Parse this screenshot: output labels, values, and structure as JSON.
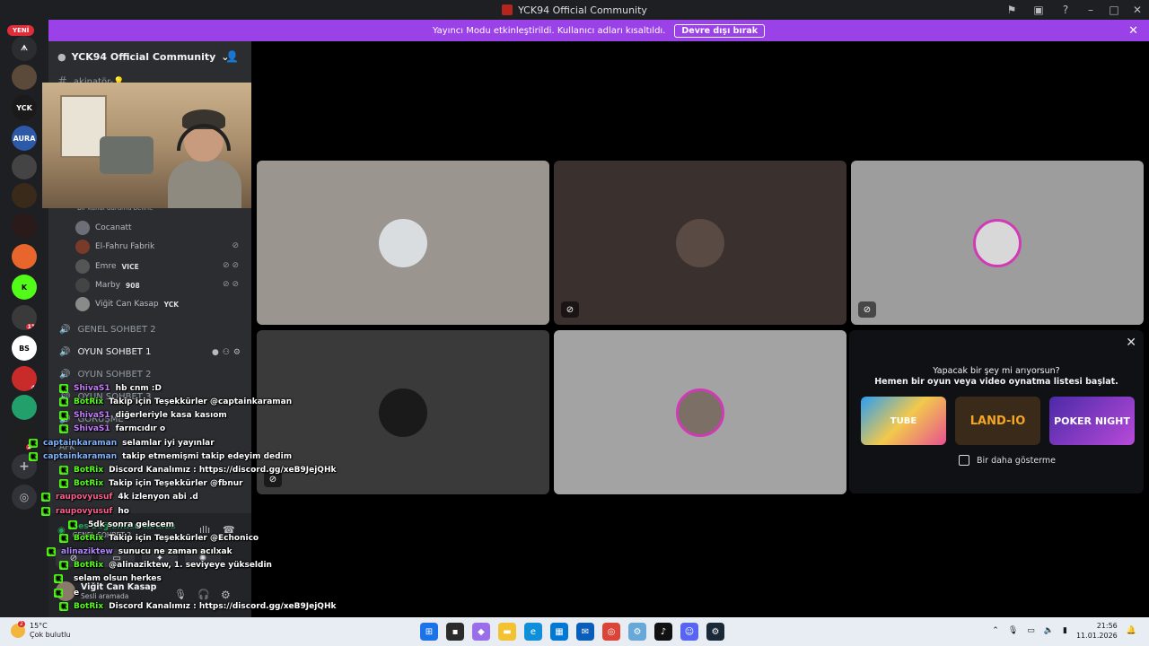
{
  "window": {
    "title": "YCK94 Official Community"
  },
  "banner": {
    "text": "Yayıncı Modu etkinleştirildi. Kullanıcı adları kısaltıldı.",
    "button": "Devre dışı bırak"
  },
  "servers": {
    "new_label": "YENİ"
  },
  "guild": {
    "name": "YCK94 Official Community",
    "top_channel": "akinatör-💡",
    "category_note": "Bir kanal durumu belirle"
  },
  "members": [
    {
      "name": "Cocanatt",
      "tag": ""
    },
    {
      "name": "El-Fahru Fabrik",
      "tag": ""
    },
    {
      "name": "Emre",
      "tag": "VICE"
    },
    {
      "name": "Marby",
      "tag": "908"
    },
    {
      "name": "Viğit Can Kasap",
      "tag": "YCK"
    }
  ],
  "voice_channels": [
    {
      "name": "GENEL SOHBET 2"
    },
    {
      "name": "OYUN SOHBET 1"
    },
    {
      "name": "OYUN SOHBET 2"
    },
    {
      "name": "OYUN SOHBET 3"
    },
    {
      "name": "GÖRÜŞME"
    },
    {
      "name": "AFK"
    }
  ],
  "user_panel": {
    "voice_status": "Ses Bağlantısı Kuruldu",
    "voice_channel": "GENEL SOHBET 2",
    "username": "Viğit Can Kasap",
    "status": "Sesli aramada"
  },
  "activity": {
    "title": "Yapacak bir şey mi arıyorsun?",
    "subtitle": "Hemen bir oyun veya video oynatma listesi başlat.",
    "games": [
      "TUBE",
      "LAND-IO",
      "POKER NIGHT"
    ],
    "dont_show": "Bir daha gösterme"
  },
  "chat": [
    {
      "user": "ShivaS1",
      "text": "hb cnm :D",
      "color": "#c77dff"
    },
    {
      "user": "BotRix",
      "text": "Takip için Teşekkürler @captainkaraman",
      "color": "#53fc18"
    },
    {
      "user": "ShivaS1",
      "text": "diğerleriyle kasa kasıom",
      "color": "#c77dff"
    },
    {
      "user": "ShivaS1",
      "text": "farmcıdır o",
      "color": "#c77dff"
    },
    {
      "user": "captainkaraman",
      "text": "selamlar iyi yayınlar",
      "color": "#7db4ff"
    },
    {
      "user": "captainkaraman",
      "text": "takip etmemişmi takip edeyim dedim",
      "color": "#7db4ff"
    },
    {
      "user": "BotRix",
      "text": "Discord Kanalımız : https://discord.gg/xeB9JejQHk",
      "color": "#53fc18"
    },
    {
      "user": "BotRix",
      "text": "Takip için Teşekkürler @fbnur",
      "color": "#53fc18"
    },
    {
      "user": "raupovyusuf",
      "text": "4k izlenyon abi .d",
      "color": "#ff5d8f"
    },
    {
      "user": "raupovyusuf",
      "text": "ho",
      "color": "#ff5d8f"
    },
    {
      "user": "",
      "text": "5dk sonra gelecem",
      "color": "#ff5d8f"
    },
    {
      "user": "BotRix",
      "text": "Takip için Teşekkürler @Echonico",
      "color": "#53fc18"
    },
    {
      "user": "alinaziktew",
      "text": "sunucu ne zaman acılxak",
      "color": "#b388ff"
    },
    {
      "user": "BotRix",
      "text": "@alinaziktew, 1. seviyeye yükseldin",
      "color": "#53fc18"
    },
    {
      "user": "",
      "text": "selam olsun herkes",
      "color": "#ff5d8f"
    },
    {
      "user": "",
      "text": "e",
      "color": "#ff5d8f"
    },
    {
      "user": "BotRix",
      "text": "Discord Kanalımız : https://discord.gg/xeB9JejQHk",
      "color": "#53fc18"
    }
  ],
  "taskbar": {
    "temp": "15°C",
    "weather": "Çok bulutlu",
    "weather_badge": "2",
    "time": "21:56",
    "date": "11.01.2026"
  }
}
